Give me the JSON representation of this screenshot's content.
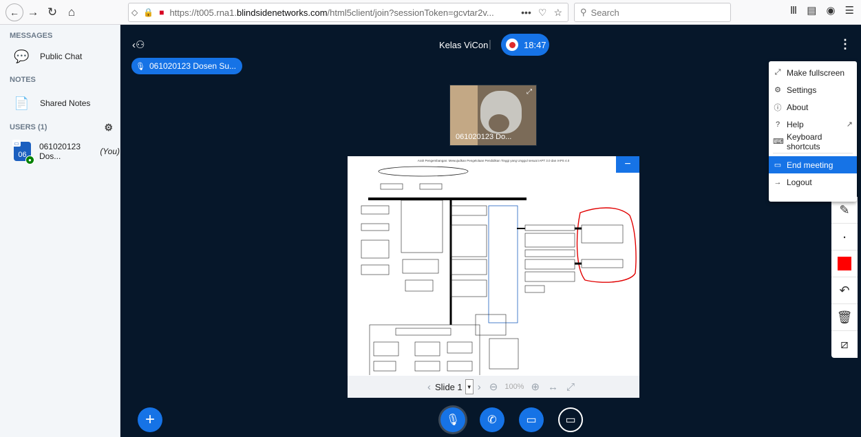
{
  "browser": {
    "url_prefix": "https://t005.rna1.",
    "url_domain": "blindsidenetworks.com",
    "url_suffix": "/html5client/join?sessionToken=gcvtar2v...",
    "more_label": "•••",
    "search_placeholder": "Search"
  },
  "sidebar": {
    "messages_title": "MESSAGES",
    "public_chat": "Public Chat",
    "notes_title": "NOTES",
    "shared_notes": "Shared Notes",
    "users_title": "USERS (1)",
    "user_initials": "06",
    "user_name": "061020123 Dos...",
    "user_you": "(You)"
  },
  "header": {
    "title": "Kelas ViCon",
    "separator": "|",
    "timer": "18:47"
  },
  "talker": {
    "name": "061020123 Dosen Su..."
  },
  "webcam": {
    "name": "061020123 Do..."
  },
  "slide": {
    "heading": "Arah Pengembangan: Mewujudkan Pengelolaan Pendidikan Tinggi yang Unggul sesuai IAPT 3.0 dan IAPS 4.0",
    "current": "Slide 1",
    "zoom": "100%"
  },
  "menu": {
    "items": [
      {
        "icon": "⤢",
        "label": "Make fullscreen"
      },
      {
        "icon": "⚙",
        "label": "Settings"
      },
      {
        "icon": "ⓘ",
        "label": "About"
      },
      {
        "icon": "?",
        "label": "Help"
      },
      {
        "icon": "⌨",
        "label": "Keyboard shortcuts"
      },
      {
        "icon": "▭",
        "label": "End meeting"
      },
      {
        "icon": "→",
        "label": "Logout"
      }
    ]
  },
  "colors": {
    "accent": "#1673e6",
    "background": "#06172a",
    "annotation": "#ff0000"
  }
}
